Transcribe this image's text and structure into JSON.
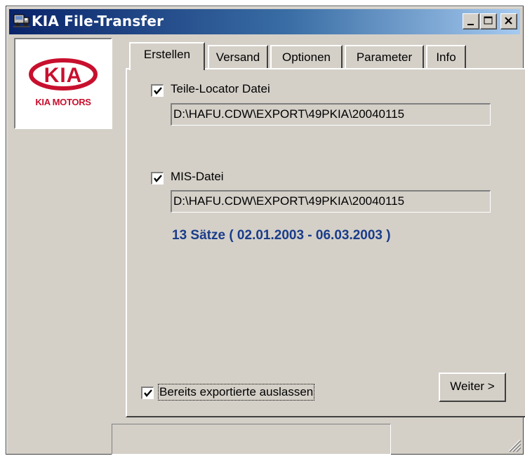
{
  "window": {
    "title": "KIA File-Transfer"
  },
  "logo": {
    "brand": "KIA",
    "subtitle": "KIA MOTORS",
    "color": "#c8102e"
  },
  "tabs": [
    {
      "label": "Erstellen",
      "active": true
    },
    {
      "label": "Versand",
      "active": false
    },
    {
      "label": "Optionen",
      "active": false
    },
    {
      "label": "Parameter",
      "active": false
    },
    {
      "label": "Info",
      "active": false
    }
  ],
  "erstellen": {
    "teile_locator": {
      "label": "Teile-Locator Datei",
      "checked": true,
      "path": "D:\\HAFU.CDW\\EXPORT\\49PKIA\\20040115"
    },
    "mis": {
      "label": "MIS-Datei",
      "checked": true,
      "path": "D:\\HAFU.CDW\\EXPORT\\49PKIA\\20040115",
      "summary": "13 Sätze ( 02.01.2003 - 06.03.2003 )"
    },
    "skip_exported": {
      "label": "Bereits exportierte auslassen",
      "checked": true
    },
    "next_button": "Weiter >"
  },
  "status": {
    "text": ""
  },
  "colors": {
    "title_gradient_start": "#0a246a",
    "title_gradient_end": "#a6caf0",
    "face": "#d4d0c8",
    "summary_text": "#1a3c8a"
  }
}
